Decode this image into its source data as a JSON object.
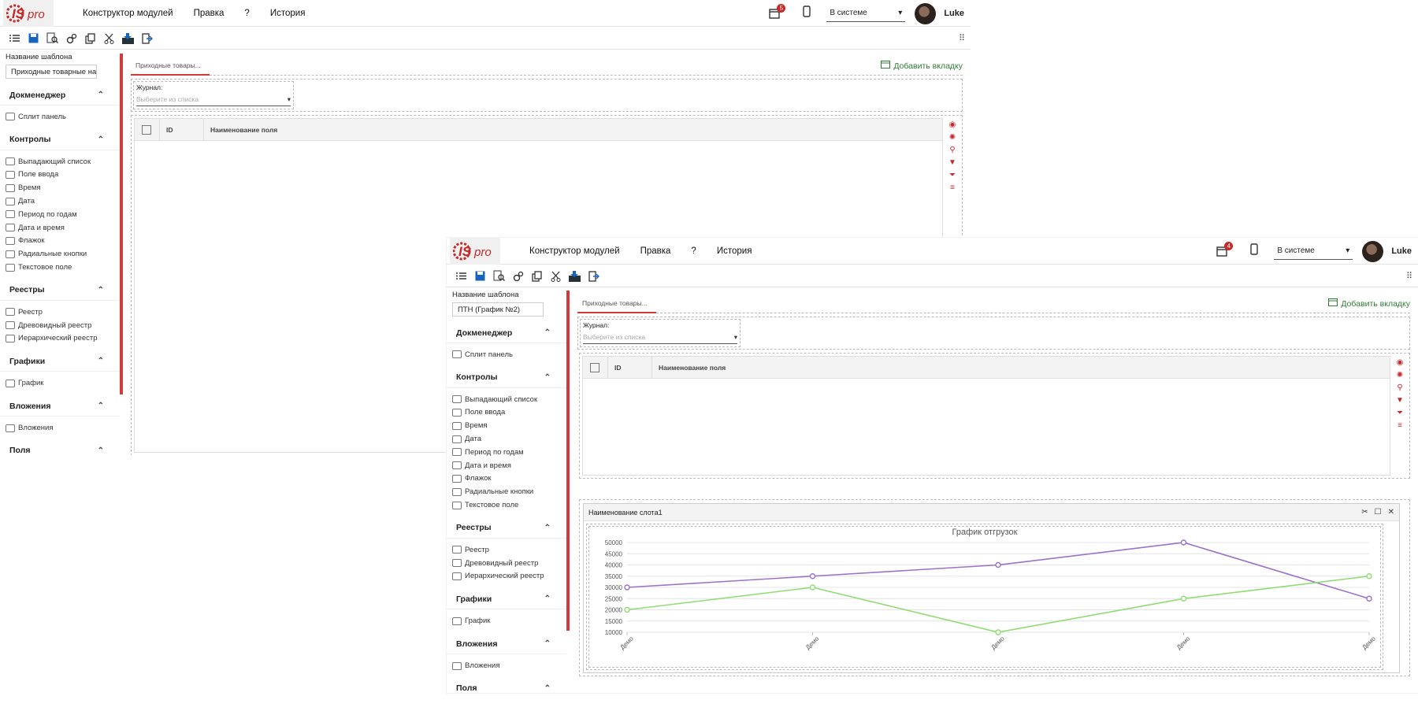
{
  "windows": [
    {
      "app": {
        "logo": "ISpro"
      },
      "menu": [
        "Конструктор модулей",
        "Правка",
        "?",
        "История"
      ],
      "notifications": "5",
      "status_select": "В системе",
      "user": "Luke",
      "sidebar": {
        "template_label": "Название шаблона",
        "template_value": "Приходные товарные на",
        "sections": [
          {
            "title": "Докменеджер",
            "items": [
              "Сплит панель"
            ]
          },
          {
            "title": "Контролы",
            "items": [
              "Выпадающий список",
              "Поле ввода",
              "Время",
              "Дата",
              "Период по годам",
              "Дата и время",
              "Флажок",
              "Радиальные кнопки",
              "Текстовое поле"
            ]
          },
          {
            "title": "Реестры",
            "items": [
              "Реестр",
              "Древовидный реестр",
              "Иерархический реестр"
            ]
          },
          {
            "title": "Графики",
            "items": [
              "График"
            ]
          },
          {
            "title": "Вложения",
            "items": [
              "Вложения"
            ]
          }
        ],
        "partial_section": "Поля"
      },
      "main": {
        "tab": "Приходные товары...",
        "add_tab": "Добавить вкладку",
        "journal_label": "Журнал:",
        "journal_placeholder": "Выберите из списка",
        "columns": [
          "ID",
          "Наименование поля"
        ]
      }
    },
    {
      "app": {
        "logo": "ISpro"
      },
      "menu": [
        "Конструктор модулей",
        "Правка",
        "?",
        "История"
      ],
      "notifications": "4",
      "status_select": "В системе",
      "user": "Luke",
      "sidebar": {
        "template_label": "Название шаблона",
        "template_value": "ПТН (График №2)",
        "sections": [
          {
            "title": "Докменеджер",
            "items": [
              "Сплит панель"
            ]
          },
          {
            "title": "Контролы",
            "items": [
              "Выпадающий список",
              "Поле ввода",
              "Время",
              "Дата",
              "Период по годам",
              "Дата и время",
              "Флажок",
              "Радиальные кнопки",
              "Текстовое поле"
            ]
          },
          {
            "title": "Реестры",
            "items": [
              "Реестр",
              "Древовидный реестр",
              "Иерархический реестр"
            ]
          },
          {
            "title": "Графики",
            "items": [
              "График"
            ]
          },
          {
            "title": "Вложения",
            "items": [
              "Вложения"
            ]
          }
        ],
        "partial_section": "Поля"
      },
      "main": {
        "tab": "Приходные товары...",
        "add_tab": "Добавить вкладку",
        "journal_label": "Журнал:",
        "journal_placeholder": "Выберите из списка",
        "columns": [
          "ID",
          "Наименование поля"
        ],
        "chart_window_title": "Наименование слота1"
      }
    }
  ],
  "colors": {
    "accent_red": "#d13b3b",
    "add_green": "#2e7d32",
    "series_purple": "#9b72c9",
    "series_green": "#8fdc72"
  },
  "chart_data": {
    "type": "line",
    "title": "График отгрузок",
    "categories": [
      "Демо",
      "Демо",
      "Демо",
      "Демо",
      "Демо"
    ],
    "series": [
      {
        "values": [
          30000,
          35000,
          40000,
          50000,
          25000
        ]
      },
      {
        "values": [
          20000,
          30000,
          10000,
          25000,
          35000
        ]
      }
    ],
    "yticks": [
      10000,
      15000,
      20000,
      25000,
      30000,
      35000,
      40000,
      45000,
      50000
    ],
    "ylim": [
      10000,
      50000
    ],
    "grid": true
  }
}
